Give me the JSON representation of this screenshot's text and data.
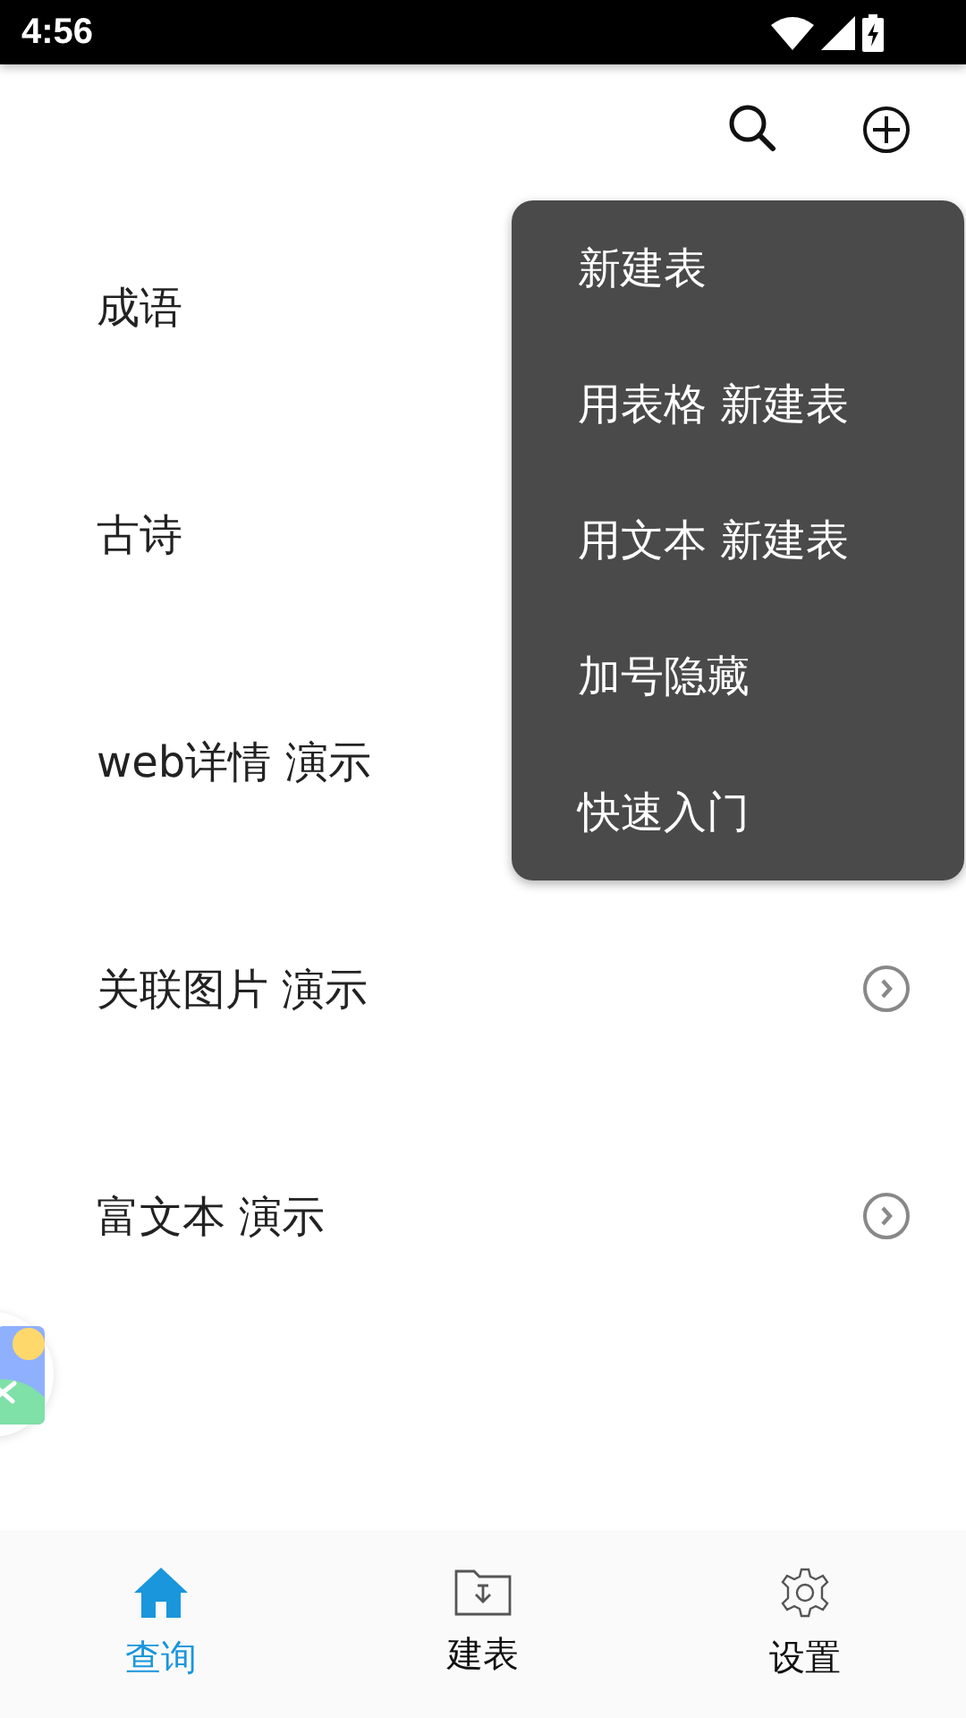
{
  "status_bar": {
    "time": "4:56"
  },
  "list": [
    {
      "label": "成语",
      "arrow": false
    },
    {
      "label": "古诗",
      "arrow": false
    },
    {
      "label": "web详情 演示",
      "arrow": false
    },
    {
      "label": "关联图片 演示",
      "arrow": true
    },
    {
      "label": "富文本 演示",
      "arrow": true
    }
  ],
  "menu": [
    "新建表",
    "用表格 新建表",
    "用文本 新建表",
    "加号隐藏",
    "快速入门"
  ],
  "bottom_nav": [
    {
      "label": "查询",
      "kind": "home",
      "selected": true
    },
    {
      "label": "建表",
      "kind": "folder",
      "selected": false
    },
    {
      "label": "设置",
      "kind": "gear",
      "selected": false
    }
  ]
}
